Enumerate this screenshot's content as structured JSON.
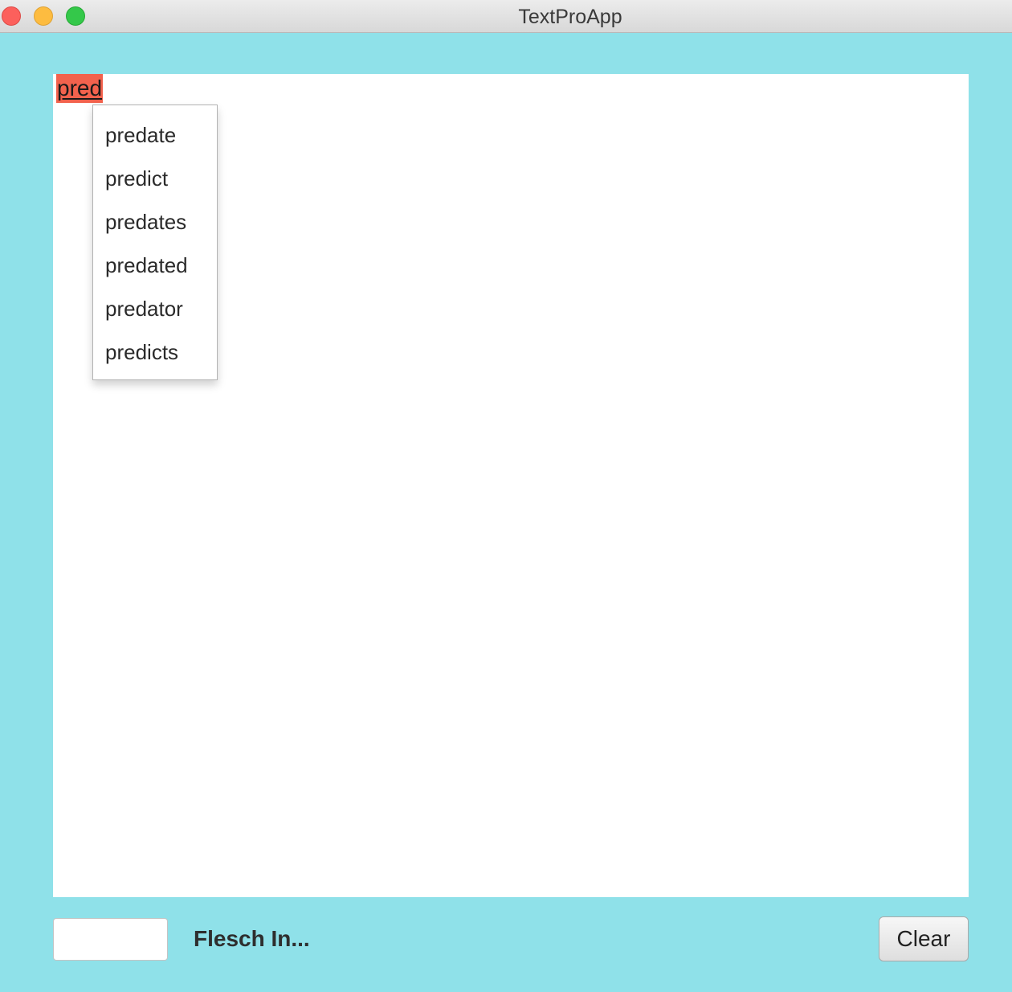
{
  "window": {
    "title": "TextProApp",
    "controls": [
      "close",
      "minimize",
      "zoom"
    ],
    "background_color": "#8fe1e9"
  },
  "editor": {
    "typed_word": "pred",
    "highlight_color": "#f2624d"
  },
  "autocomplete": {
    "suggestions": [
      "predate",
      "predict",
      "predates",
      "predated",
      "predator",
      "predicts"
    ]
  },
  "footer": {
    "score_value": "",
    "flesch_label": "Flesch In...",
    "clear_label": "Clear"
  }
}
